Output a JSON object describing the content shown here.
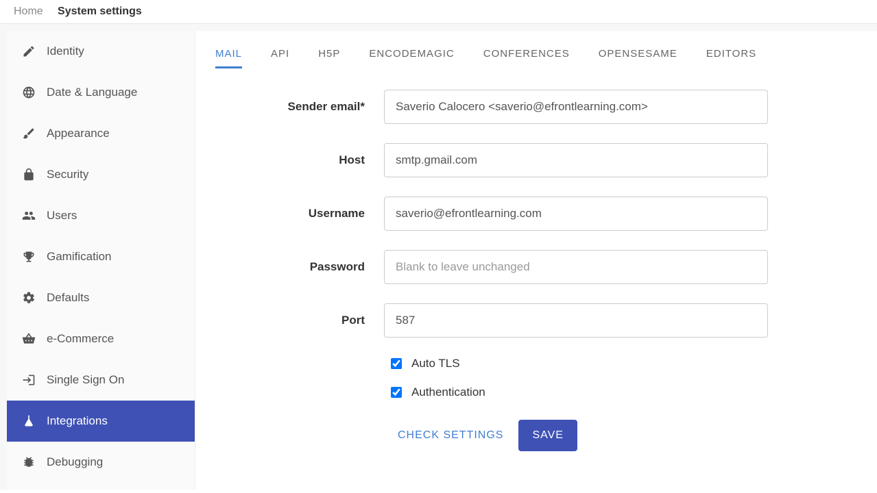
{
  "breadcrumb": {
    "home": "Home",
    "current": "System settings"
  },
  "sidebar": {
    "items": [
      {
        "label": "Identity"
      },
      {
        "label": "Date & Language"
      },
      {
        "label": "Appearance"
      },
      {
        "label": "Security"
      },
      {
        "label": "Users"
      },
      {
        "label": "Gamification"
      },
      {
        "label": "Defaults"
      },
      {
        "label": "e-Commerce"
      },
      {
        "label": "Single Sign On"
      },
      {
        "label": "Integrations"
      },
      {
        "label": "Debugging"
      }
    ]
  },
  "tabs": [
    {
      "label": "MAIL"
    },
    {
      "label": "API"
    },
    {
      "label": "H5P"
    },
    {
      "label": "ENCODEMAGIC"
    },
    {
      "label": "CONFERENCES"
    },
    {
      "label": "OPENSESAME"
    },
    {
      "label": "EDITORS"
    }
  ],
  "form": {
    "sender_label": "Sender email*",
    "sender_value": "Saverio Calocero <saverio@efrontlearning.com>",
    "host_label": "Host",
    "host_value": "smtp.gmail.com",
    "username_label": "Username",
    "username_value": "saverio@efrontlearning.com",
    "password_label": "Password",
    "password_placeholder": "Blank to leave unchanged",
    "port_label": "Port",
    "port_value": "587",
    "auto_tls_label": "Auto TLS",
    "auth_label": "Authentication",
    "check_settings": "CHECK SETTINGS",
    "save": "SAVE"
  }
}
